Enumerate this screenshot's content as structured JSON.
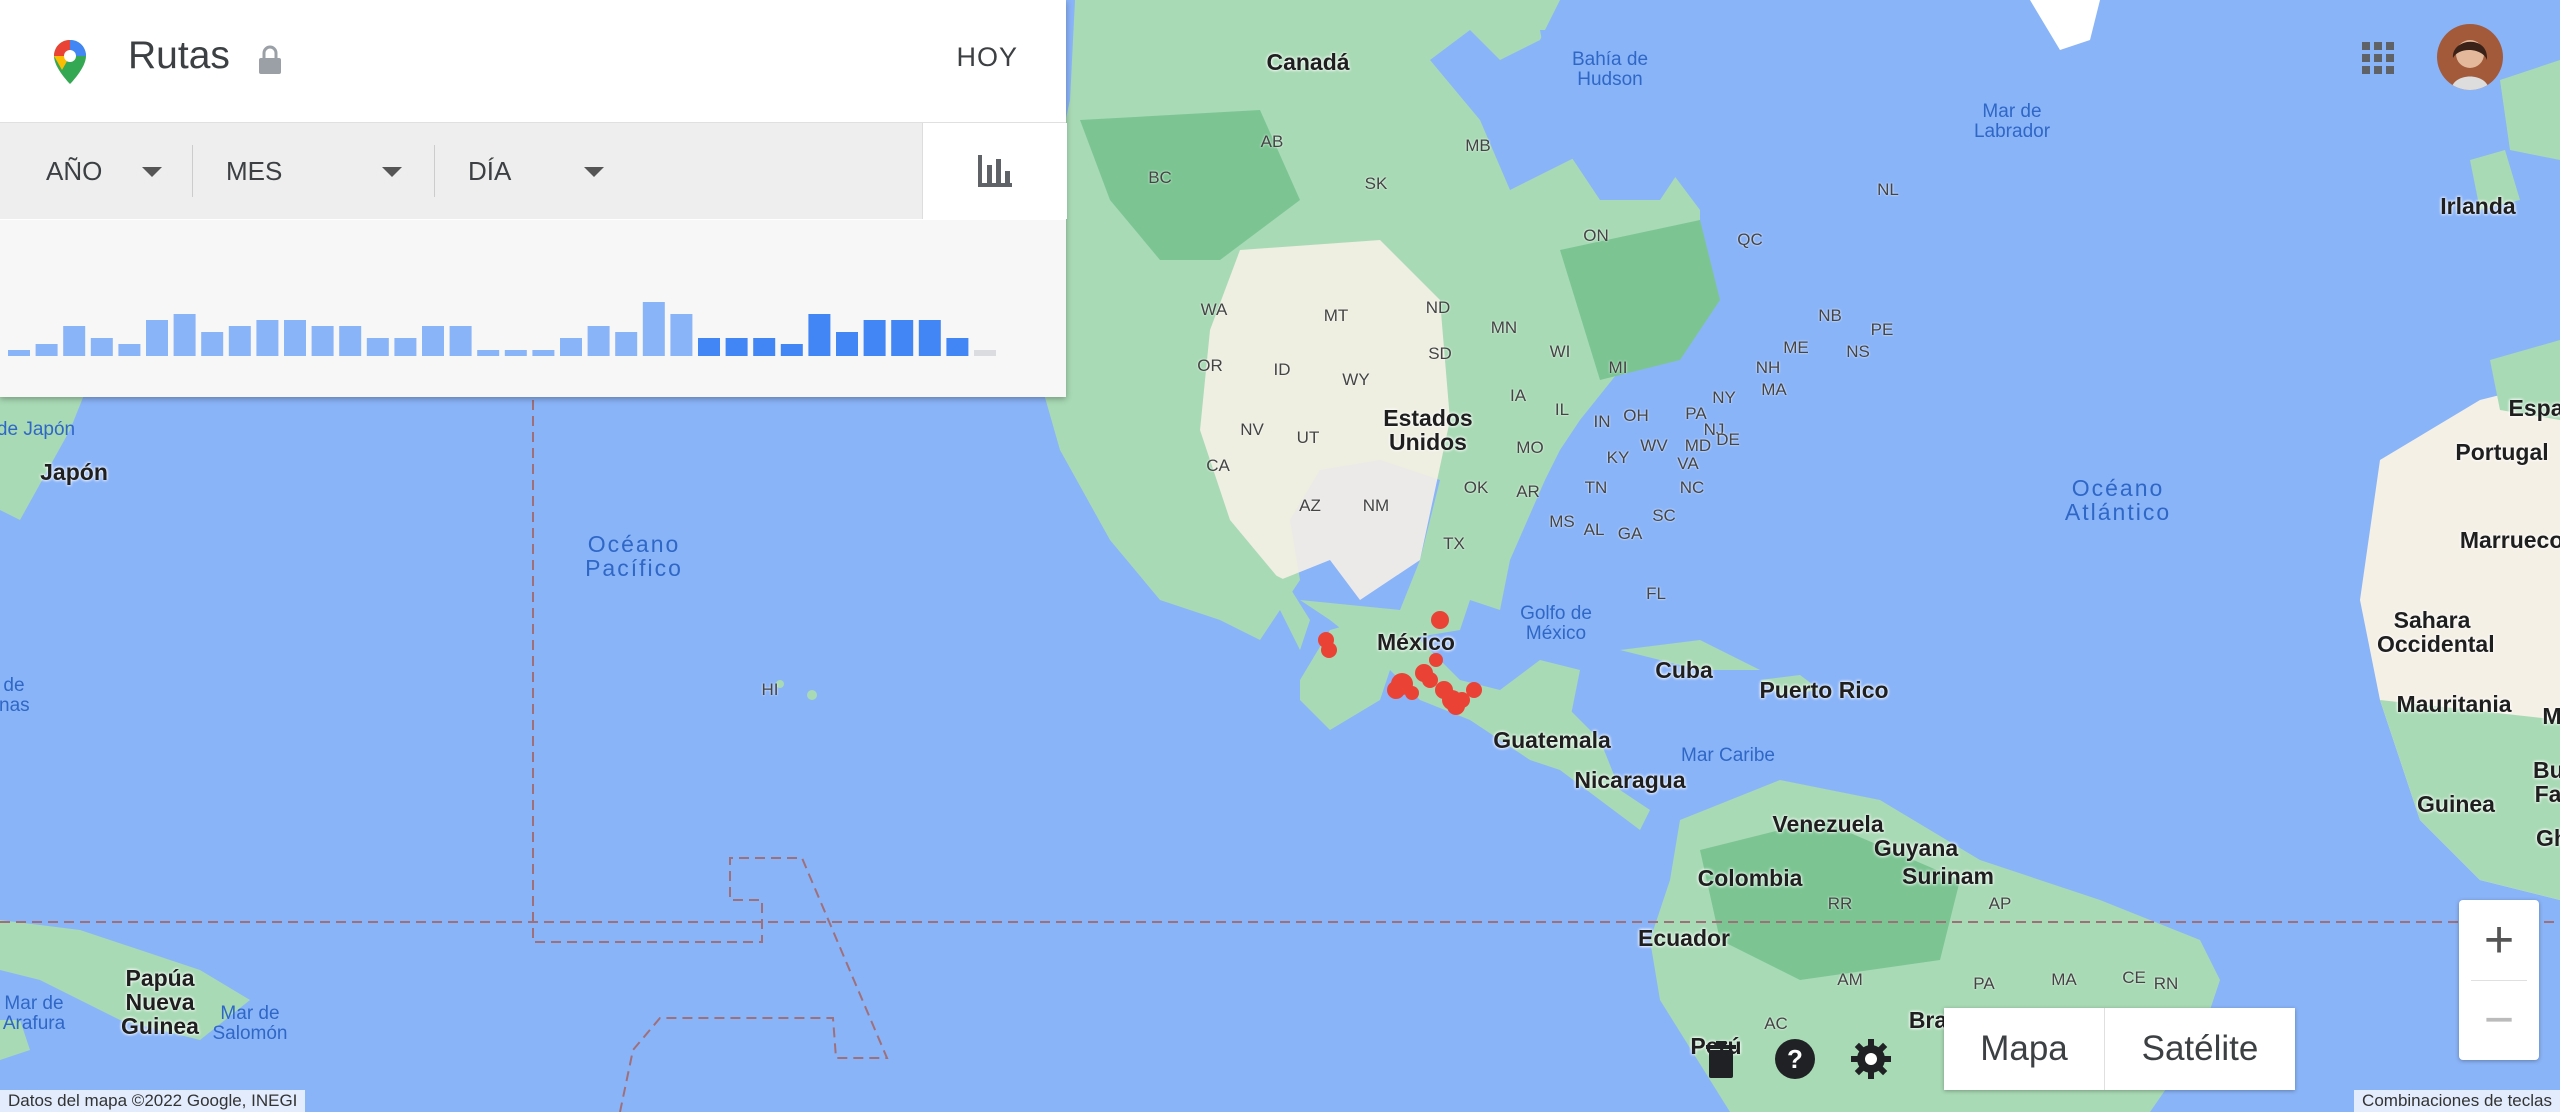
{
  "header": {
    "title": "Rutas",
    "today_label": "HOY"
  },
  "filters": [
    {
      "label": "AÑO"
    },
    {
      "label": "MES"
    },
    {
      "label": "DÍA"
    }
  ],
  "chart_data": {
    "type": "bar",
    "values": [
      1,
      2,
      5,
      3,
      2,
      6,
      7,
      4,
      5,
      6,
      6,
      5,
      5,
      3,
      3,
      5,
      5,
      1,
      1,
      1,
      3,
      5,
      4,
      9,
      7,
      3,
      3,
      3,
      2,
      7,
      4,
      6,
      6,
      6,
      3,
      1
    ],
    "highlighted_from_index": 25,
    "colors": {
      "normal": "#8ab4f8",
      "highlight": "#4285f4",
      "empty": "#dadce0"
    }
  },
  "map": {
    "countries": [
      "Canadá",
      "Estados Unidos",
      "México",
      "Cuba",
      "Puerto Rico",
      "Guatemala",
      "Nicaragua",
      "Venezuela",
      "Guyana",
      "Surinam",
      "Colombia",
      "Ecuador",
      "Perú",
      "Bra",
      "Japón",
      "Papúa Nueva Guinea",
      "Irlanda",
      "Espa",
      "Portugal",
      "Marruecos",
      "Sahara Occidental",
      "Mauritania",
      "Guinea",
      "Burl Fa",
      "Gh",
      "M"
    ],
    "oceans": [
      "Océano Pacífico",
      "Océano Atlántico"
    ],
    "seas": [
      "Bahía de Hudson",
      "Mar de Labrador",
      "Golfo de México",
      "Mar Caribe",
      "Mar de Arafura",
      "Mar de Salomón",
      "de Japón",
      "de nas"
    ],
    "states": [
      "AB",
      "MB",
      "BC",
      "SK",
      "ON",
      "QC",
      "NL",
      "WA",
      "MT",
      "ND",
      "MN",
      "WI",
      "MI",
      "NB",
      "ME",
      "NS",
      "PE",
      "NH",
      "MA",
      "OR",
      "ID",
      "WY",
      "SD",
      "IA",
      "IL",
      "IN",
      "OH",
      "PA",
      "NY",
      "NJ",
      "MD",
      "DE",
      "WV",
      "VA",
      "KY",
      "NV",
      "UT",
      "CA",
      "AZ",
      "NM",
      "OK",
      "AR",
      "MO",
      "TN",
      "NC",
      "SC",
      "MS",
      "AL",
      "GA",
      "TX",
      "FL",
      "HI",
      "RR",
      "AP",
      "AM",
      "PA",
      "MA",
      "CE",
      "RN",
      "AC"
    ]
  },
  "controls": {
    "map_label": "Mapa",
    "satellite_label": "Satélite",
    "zoom_in": "+",
    "zoom_out": "−"
  },
  "attribution": {
    "map_data": "Datos del mapa ©2022 Google, INEGI",
    "shortcuts": "Combinaciones de teclas"
  },
  "colors": {
    "water": "#8ab4f8",
    "land": "#a8dab5",
    "land_dark": "#7cc593",
    "desert": "#f5f0e6",
    "route": "#ea4335"
  }
}
